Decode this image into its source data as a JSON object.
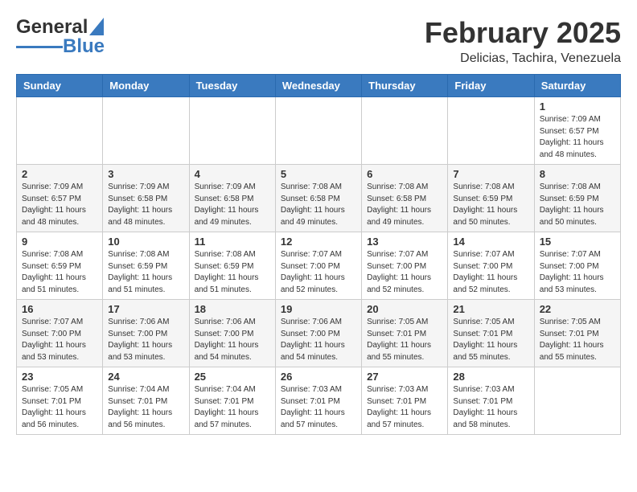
{
  "logo": {
    "general": "General",
    "blue": "Blue"
  },
  "header": {
    "month": "February 2025",
    "location": "Delicias, Tachira, Venezuela"
  },
  "weekdays": [
    "Sunday",
    "Monday",
    "Tuesday",
    "Wednesday",
    "Thursday",
    "Friday",
    "Saturday"
  ],
  "weeks": [
    [
      {
        "day": "",
        "info": ""
      },
      {
        "day": "",
        "info": ""
      },
      {
        "day": "",
        "info": ""
      },
      {
        "day": "",
        "info": ""
      },
      {
        "day": "",
        "info": ""
      },
      {
        "day": "",
        "info": ""
      },
      {
        "day": "1",
        "info": "Sunrise: 7:09 AM\nSunset: 6:57 PM\nDaylight: 11 hours\nand 48 minutes."
      }
    ],
    [
      {
        "day": "2",
        "info": "Sunrise: 7:09 AM\nSunset: 6:57 PM\nDaylight: 11 hours\nand 48 minutes."
      },
      {
        "day": "3",
        "info": "Sunrise: 7:09 AM\nSunset: 6:58 PM\nDaylight: 11 hours\nand 48 minutes."
      },
      {
        "day": "4",
        "info": "Sunrise: 7:09 AM\nSunset: 6:58 PM\nDaylight: 11 hours\nand 49 minutes."
      },
      {
        "day": "5",
        "info": "Sunrise: 7:08 AM\nSunset: 6:58 PM\nDaylight: 11 hours\nand 49 minutes."
      },
      {
        "day": "6",
        "info": "Sunrise: 7:08 AM\nSunset: 6:58 PM\nDaylight: 11 hours\nand 49 minutes."
      },
      {
        "day": "7",
        "info": "Sunrise: 7:08 AM\nSunset: 6:59 PM\nDaylight: 11 hours\nand 50 minutes."
      },
      {
        "day": "8",
        "info": "Sunrise: 7:08 AM\nSunset: 6:59 PM\nDaylight: 11 hours\nand 50 minutes."
      }
    ],
    [
      {
        "day": "9",
        "info": "Sunrise: 7:08 AM\nSunset: 6:59 PM\nDaylight: 11 hours\nand 51 minutes."
      },
      {
        "day": "10",
        "info": "Sunrise: 7:08 AM\nSunset: 6:59 PM\nDaylight: 11 hours\nand 51 minutes."
      },
      {
        "day": "11",
        "info": "Sunrise: 7:08 AM\nSunset: 6:59 PM\nDaylight: 11 hours\nand 51 minutes."
      },
      {
        "day": "12",
        "info": "Sunrise: 7:07 AM\nSunset: 7:00 PM\nDaylight: 11 hours\nand 52 minutes."
      },
      {
        "day": "13",
        "info": "Sunrise: 7:07 AM\nSunset: 7:00 PM\nDaylight: 11 hours\nand 52 minutes."
      },
      {
        "day": "14",
        "info": "Sunrise: 7:07 AM\nSunset: 7:00 PM\nDaylight: 11 hours\nand 52 minutes."
      },
      {
        "day": "15",
        "info": "Sunrise: 7:07 AM\nSunset: 7:00 PM\nDaylight: 11 hours\nand 53 minutes."
      }
    ],
    [
      {
        "day": "16",
        "info": "Sunrise: 7:07 AM\nSunset: 7:00 PM\nDaylight: 11 hours\nand 53 minutes."
      },
      {
        "day": "17",
        "info": "Sunrise: 7:06 AM\nSunset: 7:00 PM\nDaylight: 11 hours\nand 53 minutes."
      },
      {
        "day": "18",
        "info": "Sunrise: 7:06 AM\nSunset: 7:00 PM\nDaylight: 11 hours\nand 54 minutes."
      },
      {
        "day": "19",
        "info": "Sunrise: 7:06 AM\nSunset: 7:00 PM\nDaylight: 11 hours\nand 54 minutes."
      },
      {
        "day": "20",
        "info": "Sunrise: 7:05 AM\nSunset: 7:01 PM\nDaylight: 11 hours\nand 55 minutes."
      },
      {
        "day": "21",
        "info": "Sunrise: 7:05 AM\nSunset: 7:01 PM\nDaylight: 11 hours\nand 55 minutes."
      },
      {
        "day": "22",
        "info": "Sunrise: 7:05 AM\nSunset: 7:01 PM\nDaylight: 11 hours\nand 55 minutes."
      }
    ],
    [
      {
        "day": "23",
        "info": "Sunrise: 7:05 AM\nSunset: 7:01 PM\nDaylight: 11 hours\nand 56 minutes."
      },
      {
        "day": "24",
        "info": "Sunrise: 7:04 AM\nSunset: 7:01 PM\nDaylight: 11 hours\nand 56 minutes."
      },
      {
        "day": "25",
        "info": "Sunrise: 7:04 AM\nSunset: 7:01 PM\nDaylight: 11 hours\nand 57 minutes."
      },
      {
        "day": "26",
        "info": "Sunrise: 7:03 AM\nSunset: 7:01 PM\nDaylight: 11 hours\nand 57 minutes."
      },
      {
        "day": "27",
        "info": "Sunrise: 7:03 AM\nSunset: 7:01 PM\nDaylight: 11 hours\nand 57 minutes."
      },
      {
        "day": "28",
        "info": "Sunrise: 7:03 AM\nSunset: 7:01 PM\nDaylight: 11 hours\nand 58 minutes."
      },
      {
        "day": "",
        "info": ""
      }
    ]
  ]
}
